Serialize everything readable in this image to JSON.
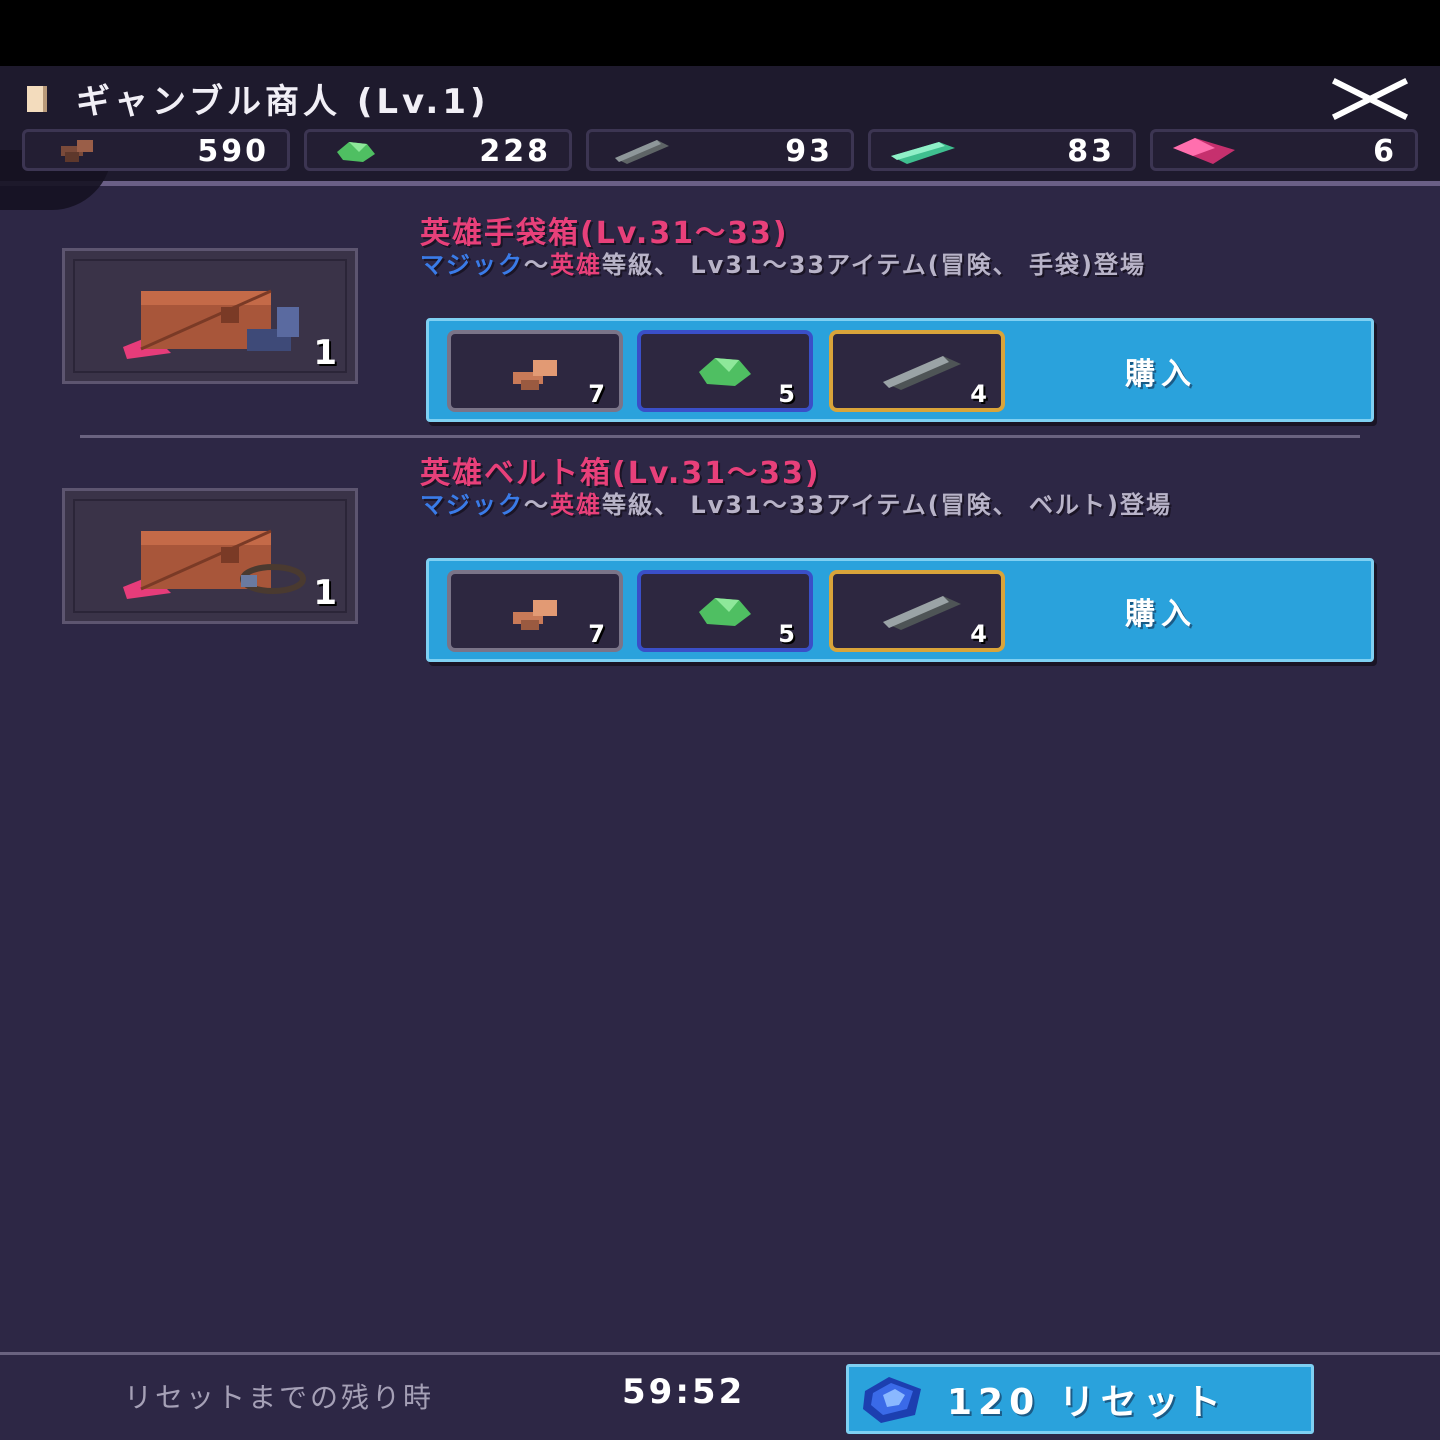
{
  "header": {
    "title": "ギャンブル商人 (Lv.1)"
  },
  "resources": [
    {
      "icon": "copper-ore-icon",
      "value": "590"
    },
    {
      "icon": "green-gem-icon",
      "value": "228"
    },
    {
      "icon": "steel-bar-icon",
      "value": "93"
    },
    {
      "icon": "mithril-bar-icon",
      "value": "83"
    },
    {
      "icon": "pink-crystal-icon",
      "value": "6"
    }
  ],
  "items": [
    {
      "title": "英雄手袋箱(Lv.31～33)",
      "desc_blue": "マジック",
      "desc_sep": "～",
      "desc_pink": "英雄",
      "desc_rest": "等級、 Lv31～33アイテム(冒険、 手袋)登場",
      "count": "1",
      "costs": [
        "7",
        "5",
        "4"
      ],
      "buy_label": "購入"
    },
    {
      "title": "英雄ベルト箱(Lv.31～33)",
      "desc_blue": "マジック",
      "desc_sep": "～",
      "desc_pink": "英雄",
      "desc_rest": "等級、 Lv31～33アイテム(冒険、 ベルト)登場",
      "count": "1",
      "costs": [
        "7",
        "5",
        "4"
      ],
      "buy_label": "購入"
    }
  ],
  "footer": {
    "reset_text": "リセットまでの残り時",
    "timer": "59:52",
    "reset_cost": "120",
    "reset_label": "リセット"
  },
  "colors": {
    "accent_blue": "#2aa2dc",
    "title_pink": "#e8407a",
    "rare_blue": "#3a7be8",
    "background": "#2d2745"
  }
}
